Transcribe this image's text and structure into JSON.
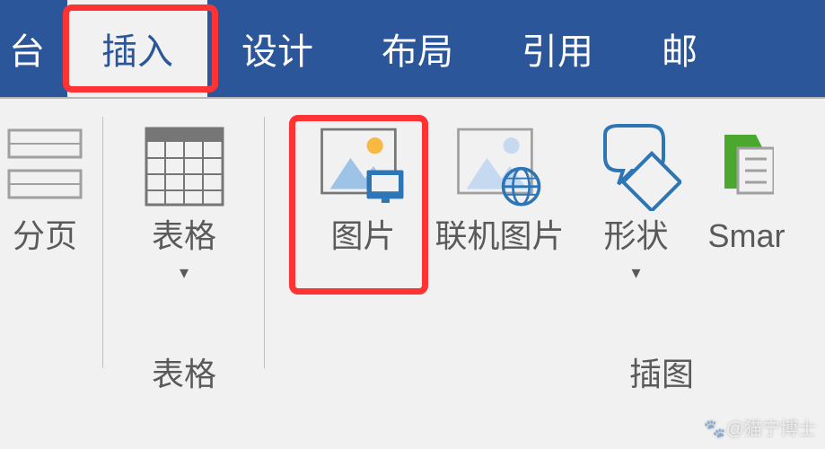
{
  "tabs": {
    "partial_left": "台",
    "insert": "插入",
    "design": "设计",
    "layout": "布局",
    "references": "引用",
    "mailings_partial": "邮"
  },
  "ribbon": {
    "page_break": "分页",
    "table": "表格",
    "table_group": "表格",
    "picture": "图片",
    "online_picture": "联机图片",
    "shapes": "形状",
    "smartart_partial": "Smar",
    "illustrations_group": "插图"
  },
  "watermark": "@猫宁博士"
}
